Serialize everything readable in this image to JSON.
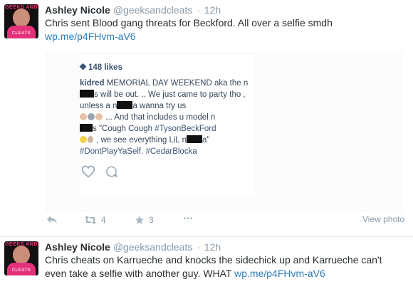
{
  "colors": {
    "link": "#2b7bb9",
    "muted": "#8899a6",
    "text": "#292f33",
    "divider": "#e1e8ed",
    "icon": "#aab8c2"
  },
  "tweets": [
    {
      "avatar_text_top": "GEEKS AND",
      "avatar_text_bottom": "CLEATS",
      "name": "Ashley Nicole",
      "handle": "@geeksandcleats",
      "separator": "·",
      "time": "12h",
      "text": "Chris sent Blood gang threats for Beckford. All over a selfie smdh ",
      "link": "wp.me/p4FHvm-aV6",
      "photo": {
        "likes": "148 likes",
        "username": "kidred",
        "caption_1": " MEMORIAL DAY WEEKEND aka the n",
        "caption_2": "s will be out. .. We just came to party tho , unless a n",
        "caption_3": "a wanna try us",
        "caption_4": " ... And that includes u model n",
        "caption_5": "s \"Cough Cough ",
        "tag_1": "#TysonBeckFord",
        "caption_6": " , we see everything LiL n",
        "caption_7": "a\" ",
        "tag_2": "#DontPlayYaSelf",
        "caption_8": ". ",
        "tag_3": "#CedarBlocka"
      },
      "view_photo": "View photo",
      "retweets": "4",
      "favorites": "3",
      "more": "•••"
    },
    {
      "avatar_text_top": "GEEKS AND",
      "avatar_text_bottom": "CLEATS",
      "name": "Ashley Nicole",
      "handle": "@geeksandcleats",
      "separator": "·",
      "time": "12h",
      "text": "Chris cheats on Karrueche and knocks the sidechick up and Karrueche can't even take a selfie with another guy. WHAT ",
      "link": "wp.me/p4FHvm-aV6"
    }
  ]
}
